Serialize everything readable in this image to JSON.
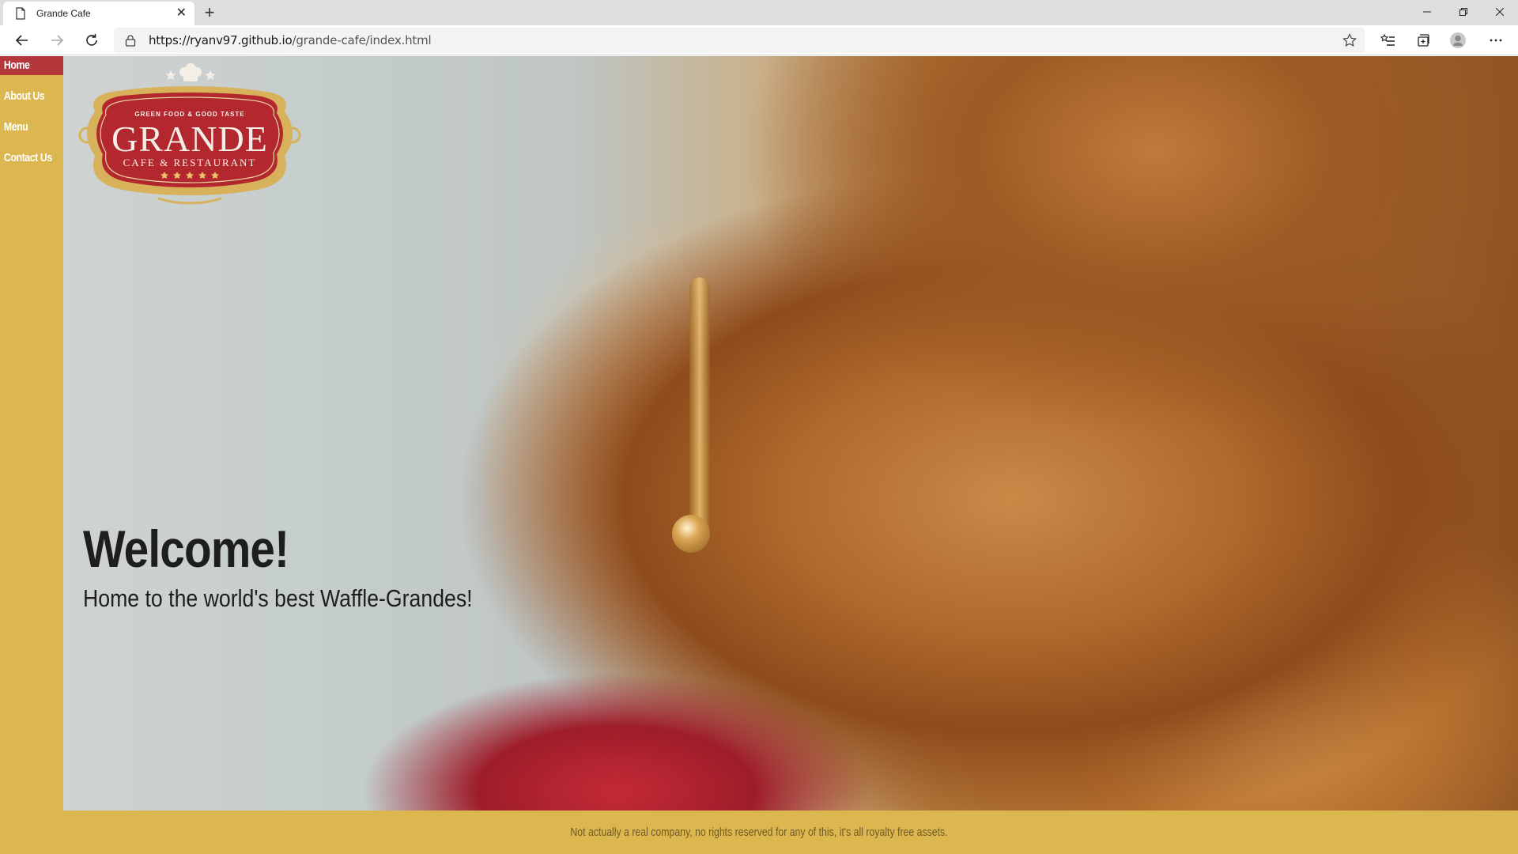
{
  "browser": {
    "tab_title": "Grande Cafe",
    "url_host": "https://ryanv97.github.io",
    "url_path": "/grande-cafe/index.html"
  },
  "nav": {
    "items": [
      {
        "label": "Home",
        "active": true
      },
      {
        "label": "About Us",
        "active": false
      },
      {
        "label": "Menu",
        "active": false
      },
      {
        "label": "Contact Us",
        "active": false
      }
    ]
  },
  "logo": {
    "top_text": "GREEN FOOD & GOOD TASTE",
    "name": "GRANDE",
    "subtitle": "CAFE & RESTAURANT"
  },
  "hero": {
    "heading": "Welcome!",
    "tagline": "Home to the world's best Waffle-Grandes!"
  },
  "footer": {
    "text": "Not actually a real company, no rights reserved for any of this, it's all royalty free assets."
  },
  "colors": {
    "brand_gold": "#dcb74f",
    "active_nav": "#b3373b",
    "logo_red": "#b3282f"
  }
}
